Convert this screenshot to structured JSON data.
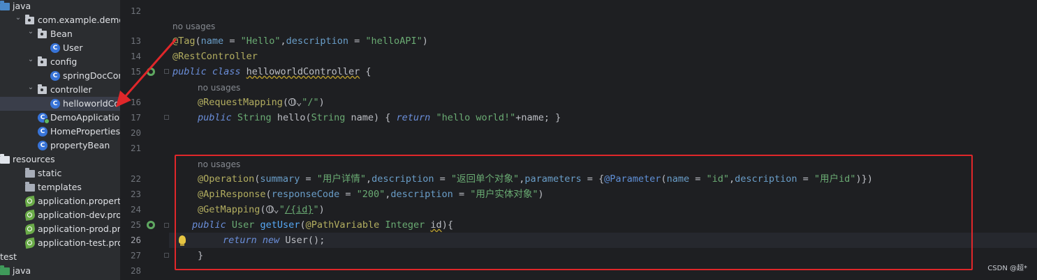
{
  "tree": {
    "items": [
      {
        "label": "java",
        "icon": "folder-blue-icon",
        "chevron": ""
      },
      {
        "label": "com.example.demo",
        "icon": "package-icon",
        "chevron": "down"
      },
      {
        "label": "Bean",
        "icon": "package-icon",
        "chevron": "down"
      },
      {
        "label": "User",
        "icon": "class-icon",
        "chevron": ""
      },
      {
        "label": "config",
        "icon": "package-icon",
        "chevron": "down"
      },
      {
        "label": "springDocConfig",
        "icon": "class-icon",
        "chevron": ""
      },
      {
        "label": "controller",
        "icon": "package-icon",
        "chevron": "down"
      },
      {
        "label": "helloworldContro",
        "icon": "class-icon",
        "chevron": ""
      },
      {
        "label": "DemoApplication",
        "icon": "class-run-icon",
        "chevron": ""
      },
      {
        "label": "HomeProperties",
        "icon": "class-icon",
        "chevron": ""
      },
      {
        "label": "propertyBean",
        "icon": "class-icon",
        "chevron": ""
      },
      {
        "label": "resources",
        "icon": "folder-resources-icon",
        "chevron": ""
      },
      {
        "label": "static",
        "icon": "folder-icon",
        "chevron": ""
      },
      {
        "label": "templates",
        "icon": "folder-icon",
        "chevron": ""
      },
      {
        "label": "application.properties",
        "icon": "spring-properties-icon",
        "chevron": ""
      },
      {
        "label": "application-dev.proper",
        "icon": "spring-properties-icon",
        "chevron": ""
      },
      {
        "label": "application-prod.prope",
        "icon": "spring-properties-icon",
        "chevron": ""
      },
      {
        "label": "application-test.proper",
        "icon": "spring-properties-icon",
        "chevron": ""
      },
      {
        "label": "test",
        "icon": "",
        "chevron": ""
      },
      {
        "label": "java",
        "icon": "folder-green-icon",
        "chevron": ""
      }
    ],
    "selected_label": "helloworldContro"
  },
  "code": {
    "line_numbers": [
      "12",
      "13",
      "14",
      "15",
      "16",
      "17",
      "20",
      "21",
      "22",
      "23",
      "24",
      "25",
      "26",
      "27",
      "28"
    ],
    "current_line": "26",
    "no_usages": "no usages",
    "l13": {
      "at": "@",
      "name": "Tag",
      "open": "(",
      "k1": "name",
      "eq1": " = ",
      "v1": "\"Hello\"",
      "c1": ",",
      "k2": "description",
      "eq2": " = ",
      "v2": "\"helloAPI\"",
      "close": ")"
    },
    "l14": {
      "text": "@RestController"
    },
    "l15": {
      "mod": "public class ",
      "name": "helloworldController",
      "rest": " {"
    },
    "l16": {
      "ann": "@RequestMapping",
      "open": "(",
      "chev": "⌄",
      "val": "\"/\"",
      "close": ")"
    },
    "l17": {
      "mod": "public ",
      "type": "String ",
      "name": "hello",
      "open": "(",
      "ptype": "String ",
      "pname": "name",
      "mid": ") { ",
      "ret": "return ",
      "str": "\"hello world!\"",
      "tail": "+name; }"
    },
    "l22": {
      "ann": "@Operation",
      "open": "(",
      "k1": "summary",
      "v1": "\"用户详情\"",
      "c1": ",",
      "k2": "description",
      "v2": "\"返回单个对象\"",
      "c2": ",",
      "k3": "parameters",
      "eq": " = ",
      "brace": "{",
      "ann2": "@Parameter",
      "open2": "(",
      "k4": "name",
      "v4": "\"id\"",
      "c4": ",",
      "k5": "description",
      "v5": "\"用户id\"",
      "close": ")})"
    },
    "l23": {
      "ann": "@ApiResponse",
      "open": "(",
      "k1": "responseCode",
      "v1": "\"200\"",
      "c1": ",",
      "k2": "description",
      "v2": "\"用户实体对象\"",
      "close": ")"
    },
    "l24": {
      "ann": "@GetMapping",
      "open": "(",
      "chev": "⌄",
      "q1": "\"",
      "path": "/{id}",
      "q2": "\"",
      "close": ")"
    },
    "l25": {
      "mod": "public ",
      "type": "User ",
      "name": "getUser",
      "open": "(",
      "pann": "@PathVariable",
      "ptype": " Integer ",
      "pname": "id",
      "close": "){"
    },
    "l26": {
      "ret": "return ",
      "kw": "new ",
      "rest": "User();"
    },
    "l27": {
      "text": "}"
    },
    "eq": " = "
  },
  "watermark": "CSDN @超*"
}
